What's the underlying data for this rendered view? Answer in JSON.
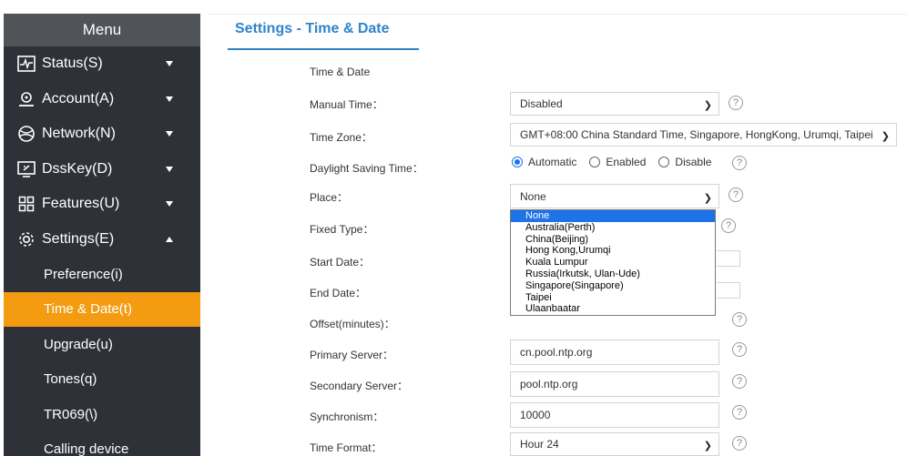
{
  "sidebar": {
    "menu_title": "Menu",
    "items": [
      {
        "label": "Status(S)",
        "icon": "status-icon"
      },
      {
        "label": "Account(A)",
        "icon": "account-icon"
      },
      {
        "label": "Network(N)",
        "icon": "network-icon"
      },
      {
        "label": "DssKey(D)",
        "icon": "dsskey-icon"
      },
      {
        "label": "Features(U)",
        "icon": "features-icon"
      },
      {
        "label": "Settings(E)",
        "icon": "settings-icon"
      }
    ],
    "sub_items": [
      "Preference(i)",
      "Time & Date(t)",
      "Upgrade(u)",
      "Tones(q)",
      "TR069(\\)",
      "Calling device"
    ]
  },
  "page": {
    "title": "Settings - Time & Date",
    "section_label": "Time & Date"
  },
  "form": {
    "manual_time": {
      "label": "Manual Time：",
      "value": "Disabled"
    },
    "time_zone": {
      "label": "Time Zone：",
      "value": "GMT+08:00 China Standard Time, Singapore, HongKong, Urumqi, Taipei"
    },
    "dst": {
      "label": "Daylight Saving Time：",
      "options": [
        "Automatic",
        "Enabled",
        "Disable"
      ],
      "selected": "Automatic"
    },
    "place": {
      "label": "Place：",
      "value": "None"
    },
    "fixed_type": {
      "label": "Fixed Type："
    },
    "start_date": {
      "label": "Start Date："
    },
    "end_date": {
      "label": "End Date："
    },
    "offset": {
      "label": "Offset(minutes)："
    },
    "primary_server": {
      "label": "Primary Server：",
      "value": "cn.pool.ntp.org"
    },
    "secondary_server": {
      "label": "Secondary Server：",
      "value": "pool.ntp.org"
    },
    "synchronism": {
      "label": "Synchronism：",
      "value": "10000"
    },
    "time_format": {
      "label": "Time Format：",
      "value": "Hour 24"
    }
  },
  "place_dropdown": {
    "options": [
      "None",
      "Australia(Perth)",
      "China(Beijing)",
      "Hong Kong,Urumqi",
      "Kuala Lumpur",
      "Russia(Irkutsk, Ulan-Ude)",
      "Singapore(Singapore)",
      "Taipei",
      "Ulaanbaatar"
    ],
    "highlighted": "None"
  },
  "help_glyph": "?",
  "colors": {
    "accent": "#2f83c9",
    "active_nav": "#f39c12",
    "sidebar_bg": "#2e3238",
    "menu_head": "#505357",
    "highlight": "#1e73e8"
  }
}
